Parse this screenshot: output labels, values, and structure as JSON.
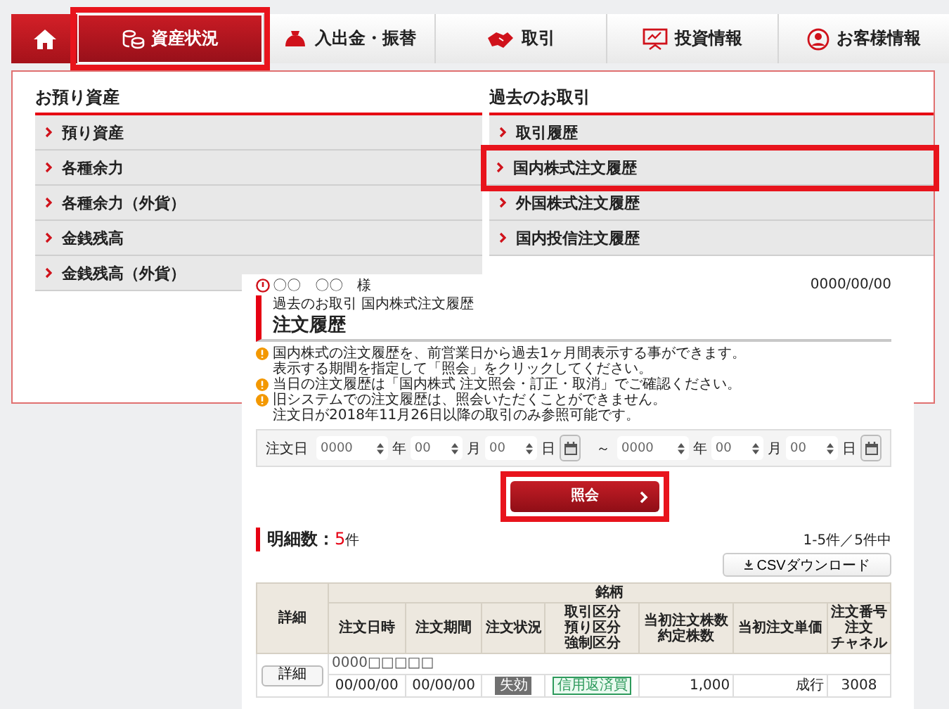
{
  "nav": {
    "tabs": [
      {
        "kind": "home",
        "selected": false,
        "highlighted": false
      },
      {
        "kind": "coins",
        "label": "資産状況",
        "selected": true,
        "highlighted": true
      },
      {
        "kind": "purse",
        "label": "入出金・振替",
        "selected": false,
        "highlighted": false
      },
      {
        "kind": "trade",
        "label": "取引",
        "selected": false,
        "highlighted": false
      },
      {
        "kind": "board",
        "label": "投資情報",
        "selected": false,
        "highlighted": false
      },
      {
        "kind": "person",
        "label": "お客様情報",
        "selected": false,
        "highlighted": false
      }
    ]
  },
  "menu": {
    "columns": [
      {
        "heading": "お預り資産",
        "items": [
          {
            "label": "預り資産",
            "highlighted": false
          },
          {
            "label": "各種余力",
            "highlighted": false
          },
          {
            "label": "各種余力（外貨）",
            "highlighted": false
          },
          {
            "label": "金銭残高",
            "highlighted": false
          },
          {
            "label": "金銭残高（外貨）",
            "highlighted": false
          }
        ]
      },
      {
        "heading": "過去のお取引",
        "items": [
          {
            "label": "取引履歴",
            "highlighted": false
          },
          {
            "label": "国内株式注文履歴",
            "highlighted": true
          },
          {
            "label": "外国株式注文履歴",
            "highlighted": false
          },
          {
            "label": "国内投信注文履歴",
            "highlighted": false
          }
        ]
      }
    ]
  },
  "inset": {
    "customer": "〇〇　〇〇　様",
    "date": "0000/00/00",
    "breadcrumb": "過去のお取引 国内株式注文履歴",
    "title": "注文履歴",
    "notes": [
      {
        "lines": [
          "国内株式の注文履歴を、前営業日から過去1ヶ月間表示する事ができます。",
          "表示する期間を指定して「照会」をクリックしてください。"
        ]
      },
      {
        "lines": [
          "当日の注文履歴は「国内株式 注文照会・訂正・取消」でご確認ください。"
        ]
      },
      {
        "lines": [
          "旧システムでの注文履歴は、照会いただくことができません。",
          "注文日が2018年11月26日以降の取引のみ参照可能です。"
        ]
      }
    ],
    "form": {
      "label": "注文日",
      "fields": [
        {
          "kind": "select",
          "value": "0000"
        },
        {
          "kind": "unit",
          "text": "年"
        },
        {
          "kind": "select",
          "value": "00"
        },
        {
          "kind": "unit",
          "text": "月"
        },
        {
          "kind": "select",
          "value": "00"
        },
        {
          "kind": "unit",
          "text": "日"
        },
        {
          "kind": "calendar"
        },
        {
          "kind": "separator",
          "text": "～"
        },
        {
          "kind": "select",
          "value": "0000"
        },
        {
          "kind": "unit",
          "text": "年"
        },
        {
          "kind": "select",
          "value": "00"
        },
        {
          "kind": "unit",
          "text": "月"
        },
        {
          "kind": "select",
          "value": "00"
        },
        {
          "kind": "unit",
          "text": "日"
        },
        {
          "kind": "calendar"
        }
      ]
    },
    "search_button": {
      "label": "照会",
      "highlighted": true
    },
    "summary": {
      "label": "明細数：",
      "count": "5",
      "unit": "件",
      "range": "1-5件／5件中"
    },
    "csv_button": "CSVダウンロード",
    "table": {
      "header_rows": [
        [
          {
            "lines": [
              "詳細"
            ],
            "rowspan": 2
          },
          {
            "lines": [
              "銘柄"
            ],
            "colspan": 7
          }
        ],
        [
          {
            "lines": [
              "注文日時"
            ]
          },
          {
            "lines": [
              "注文期間"
            ]
          },
          {
            "lines": [
              "注文状況"
            ]
          },
          {
            "lines": [
              "取引区分",
              "預り区分",
              "強制区分"
            ]
          },
          {
            "lines": [
              "当初注文株数",
              "約定株数"
            ]
          },
          {
            "lines": [
              "当初注文単価"
            ]
          },
          {
            "lines": [
              "注文番号",
              "注文",
              "チャネル"
            ]
          }
        ]
      ],
      "rows": [
        {
          "title": "0000□□□□□",
          "detail_button": "詳細",
          "cells": [
            {
              "kind": "text",
              "text": "00/00/00"
            },
            {
              "kind": "text",
              "text": "00/00/00"
            },
            {
              "kind": "badge",
              "text": "失効",
              "color": "#707070"
            },
            {
              "kind": "badge",
              "text": "信用返済買",
              "color": "#2e9a5c"
            },
            {
              "kind": "number",
              "text": "1,000"
            },
            {
              "kind": "number",
              "text": "成行"
            },
            {
              "kind": "text",
              "text": "3008"
            }
          ]
        }
      ]
    }
  }
}
